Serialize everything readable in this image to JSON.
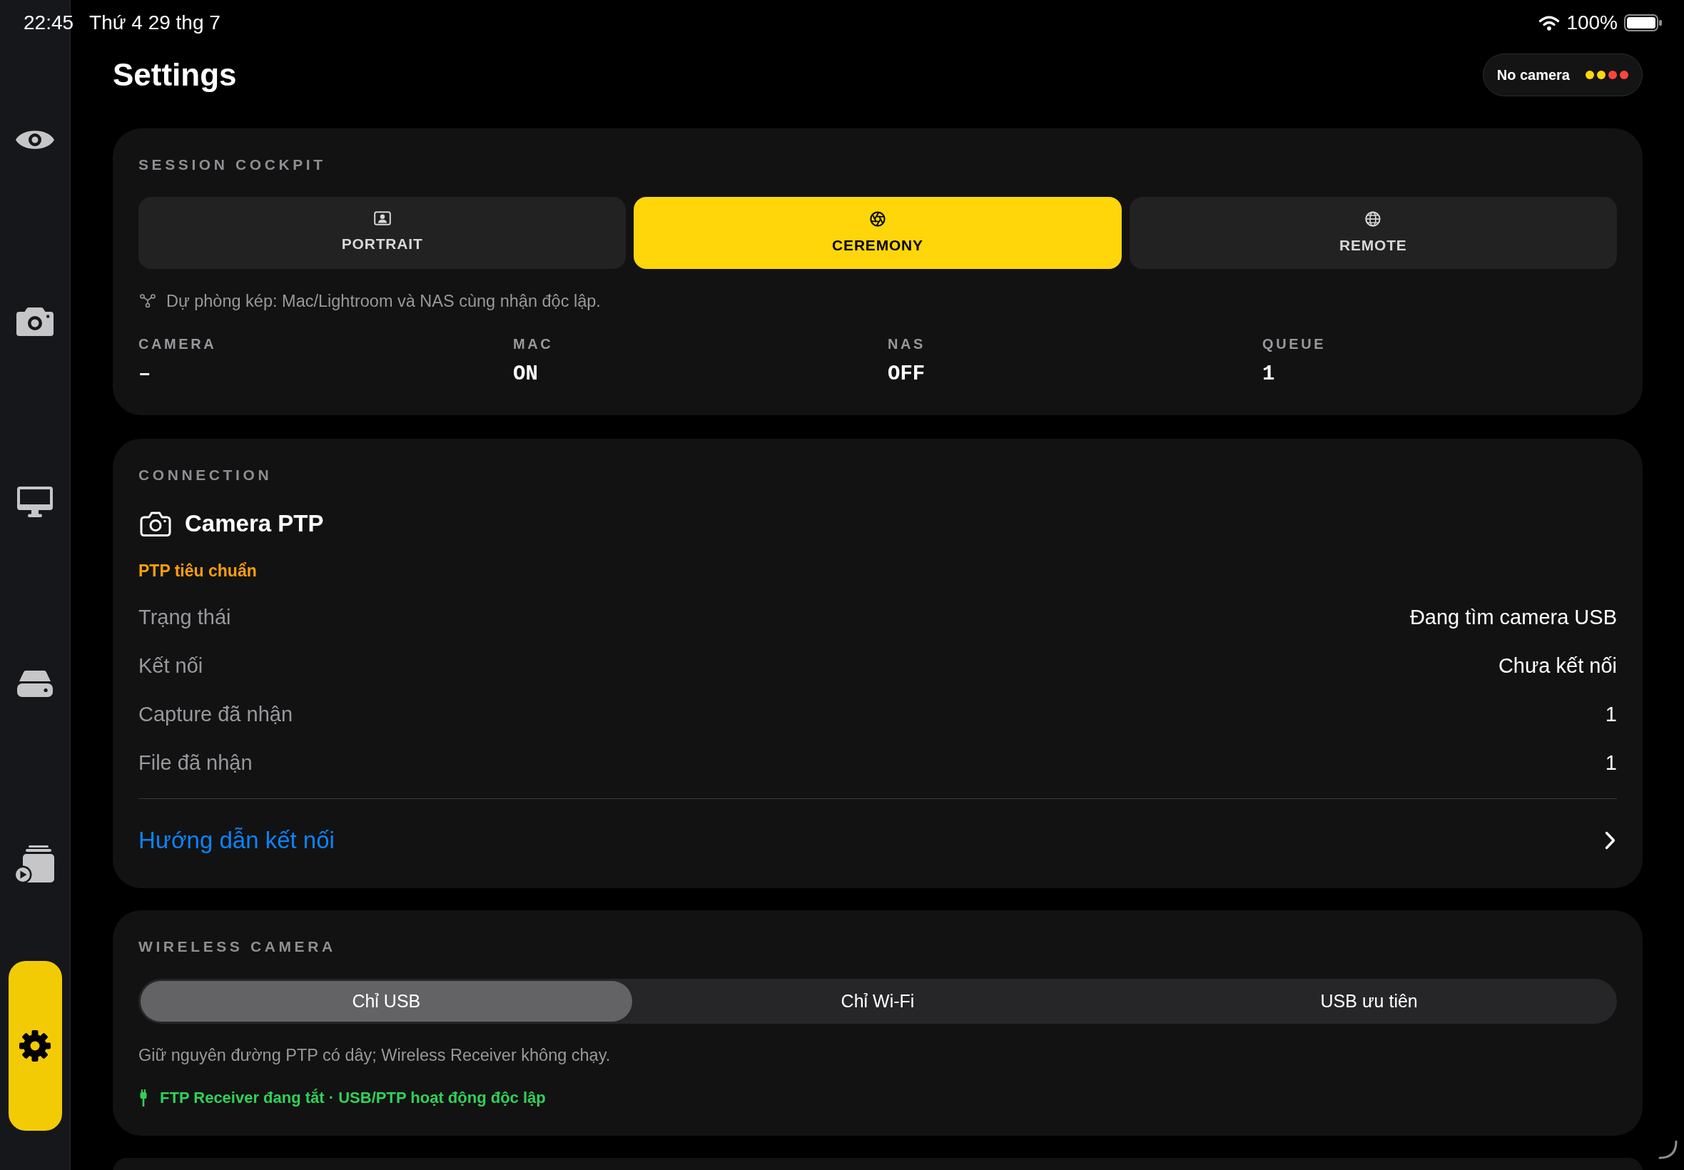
{
  "status_bar": {
    "time": "22:45",
    "date": "Thứ 4 29 thg 7",
    "battery": "100%"
  },
  "sidebar": {
    "items": [
      {
        "selected": false
      },
      {
        "selected": false
      },
      {
        "selected": false
      },
      {
        "selected": false
      },
      {
        "selected": false
      },
      {
        "selected": true
      }
    ]
  },
  "header": {
    "title": "Settings",
    "camera_status": {
      "label": "No camera",
      "dots": [
        {
          "color": "#ffd60a"
        },
        {
          "color": "#ffd60a"
        },
        {
          "color": "#ff453a"
        },
        {
          "color": "#ff453a"
        }
      ]
    }
  },
  "session_cockpit": {
    "title": "SESSION COCKPIT",
    "modes": [
      {
        "label": "PORTRAIT",
        "selected": false
      },
      {
        "label": "CEREMONY",
        "selected": true
      },
      {
        "label": "REMOTE",
        "selected": false
      }
    ],
    "note": "Dự phòng kép: Mac/Lightroom và NAS cùng nhận độc lập.",
    "stats": [
      {
        "label": "CAMERA",
        "value": "–"
      },
      {
        "label": "MAC",
        "value": "ON"
      },
      {
        "label": "NAS",
        "value": "OFF"
      },
      {
        "label": "QUEUE",
        "value": "1"
      }
    ]
  },
  "connection": {
    "title": "CONNECTION",
    "device": "Camera PTP",
    "mode": "PTP tiêu chuẩn",
    "rows": [
      {
        "label": "Trạng thái",
        "value": "Đang tìm camera USB"
      },
      {
        "label": "Kết nối",
        "value": "Chưa kết nối"
      },
      {
        "label": "Capture đã nhận",
        "value": "1"
      },
      {
        "label": "File đã nhận",
        "value": "1"
      }
    ],
    "link": "Hướng dẫn kết nối"
  },
  "wireless_camera": {
    "title": "WIRELESS CAMERA",
    "options": [
      {
        "label": "Chỉ USB",
        "selected": true
      },
      {
        "label": "Chỉ Wi-Fi",
        "selected": false
      },
      {
        "label": "USB ưu tiên",
        "selected": false
      }
    ],
    "description": "Giữ nguyên đường PTP có dây; Wireless Receiver không chạy.",
    "status": "FTP Receiver đang tắt · USB/PTP hoạt động độc lập"
  }
}
